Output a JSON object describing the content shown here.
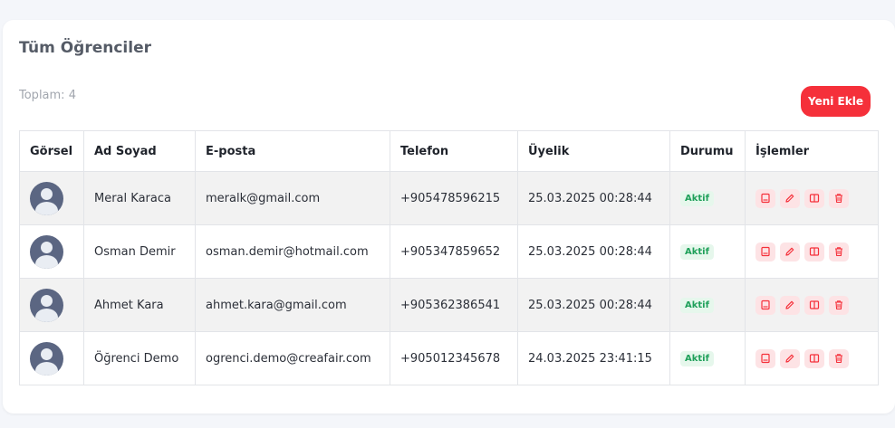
{
  "page": {
    "title": "Tüm Öğrenciler",
    "total_label": "Toplam: 4",
    "add_button_label": "Yeni Ekle"
  },
  "colors": {
    "accent": "#f5303a",
    "status_active_bg": "#e6f7ec",
    "status_active_text": "#1fa05a",
    "action_bg": "#fde3e5",
    "action_icon": "#f5303a"
  },
  "table": {
    "headers": [
      "Görsel",
      "Ad Soyad",
      "E-posta",
      "Telefon",
      "Üyelik",
      "Durumu",
      "İşlemler"
    ],
    "rows": [
      {
        "name": "Meral Karaca",
        "email": "meralk@gmail.com",
        "phone": "+905478596215",
        "membership": "25.03.2025 00:28:44",
        "status": "Aktif"
      },
      {
        "name": "Osman Demir",
        "email": "osman.demir@hotmail.com",
        "phone": "+905347859652",
        "membership": "25.03.2025 00:28:44",
        "status": "Aktif"
      },
      {
        "name": "Ahmet Kara",
        "email": "ahmet.kara@gmail.com",
        "phone": "+905362386541",
        "membership": "25.03.2025 00:28:44",
        "status": "Aktif"
      },
      {
        "name": "Öğrenci Demo",
        "email": "ogrenci.demo@creafair.com",
        "phone": "+905012345678",
        "membership": "24.03.2025 23:41:15",
        "status": "Aktif"
      }
    ],
    "row_actions": [
      "book-icon",
      "edit-icon",
      "open-book-icon",
      "trash-icon"
    ]
  }
}
